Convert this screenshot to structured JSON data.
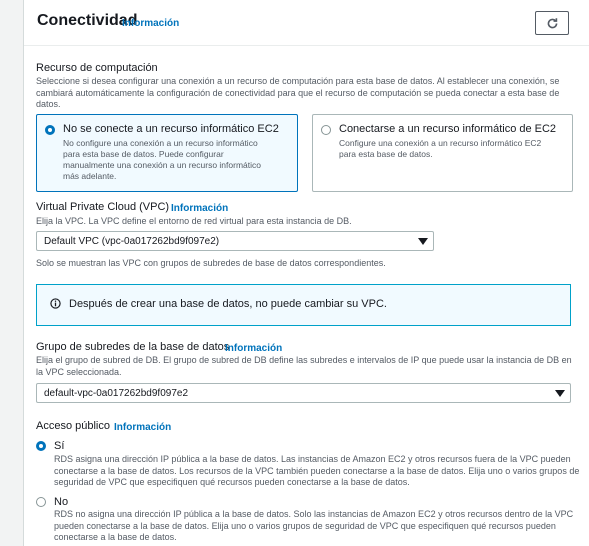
{
  "section": {
    "title": "Conectividad",
    "info": "Información"
  },
  "compute": {
    "label": "Recurso de computación",
    "desc_lines": [
      "Seleccione si desea configurar una conexión a un recurso de computación para esta base de datos. Al establecer una conexión, se",
      "cambiará automáticamente la configuración de conectividad para que el recurso de computación se pueda conectar a esta base de",
      "datos."
    ],
    "options": [
      {
        "title": "No se conecte a un recurso informático EC2",
        "desc_lines": [
          "No configure una conexión a un recurso informático",
          "para esta base de datos. Puede configurar",
          "manualmente una conexión a un recurso informático",
          "más adelante."
        ],
        "selected": true
      },
      {
        "title": "Conectarse a un recurso informático de EC2",
        "desc_lines": [
          "Configure una conexión a un recurso informático EC2",
          "para esta base de datos."
        ],
        "selected": false
      }
    ]
  },
  "vpc": {
    "label": "Virtual Private Cloud (VPC)",
    "info": "Información",
    "desc": "Elija la VPC. La VPC define el entorno de red virtual para esta instancia de DB.",
    "value": "Default VPC (vpc-0a017262bd9f097e2)",
    "hint": "Solo se muestran las VPC con grupos de subredes de base de datos correspondientes."
  },
  "alert": {
    "text": "Después de crear una base de datos, no puede cambiar su VPC."
  },
  "subnet": {
    "label": "Grupo de subredes de la base de datos",
    "info": "Información",
    "desc_lines": [
      "Elija el grupo de subred de DB. El grupo de subred de DB define las subredes e intervalos de IP que puede usar la instancia de DB en",
      "la VPC seleccionada."
    ],
    "value": "default-vpc-0a017262bd9f097e2"
  },
  "public_access": {
    "label": "Acceso público",
    "info": "Información",
    "options": [
      {
        "title": "Sí",
        "selected": true,
        "desc_lines": [
          "RDS asigna una dirección IP pública a la base de datos. Las instancias de Amazon EC2 y otros recursos fuera de la VPC pueden",
          "conectarse a la base de datos. Los recursos de la VPC también pueden conectarse a la base de datos. Elija uno o varios grupos de",
          "seguridad de VPC que especifiquen qué recursos pueden conectarse a la base de datos."
        ]
      },
      {
        "title": "No",
        "selected": false,
        "desc_lines": [
          "RDS no asigna una dirección IP pública a la base de datos. Solo las instancias de Amazon EC2 y otros recursos dentro de la VPC",
          "pueden conectarse a la base de datos. Elija uno o varios grupos de seguridad de VPC que especifiquen qué recursos pueden",
          "conectarse a la base de datos."
        ]
      }
    ]
  },
  "colors": {
    "accent": "#0073bb",
    "info_border": "#00a1c9",
    "selected_bg": "#f1faff"
  }
}
